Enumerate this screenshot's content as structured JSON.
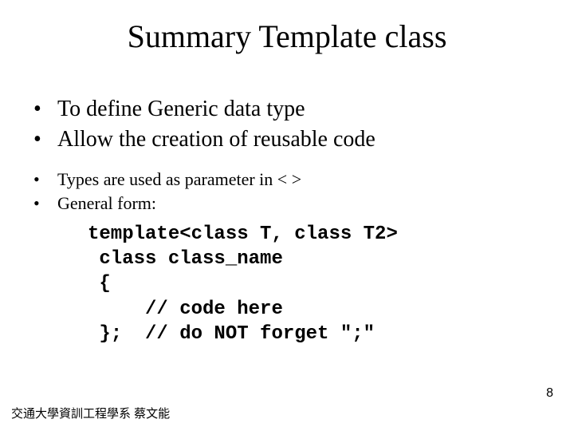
{
  "title": "Summary   Template class",
  "bullets_large": [
    "To define Generic data type",
    "Allow the creation of reusable code"
  ],
  "bullets_small": [
    "Types are used as parameter in <   >",
    "General form:"
  ],
  "code_lines": [
    "template<class T, class T2>",
    " class class_name",
    " {",
    "     // code here",
    " };  // do NOT forget \";\""
  ],
  "footer": "交通大學資訓工程學系 蔡文能",
  "page_number": "8"
}
